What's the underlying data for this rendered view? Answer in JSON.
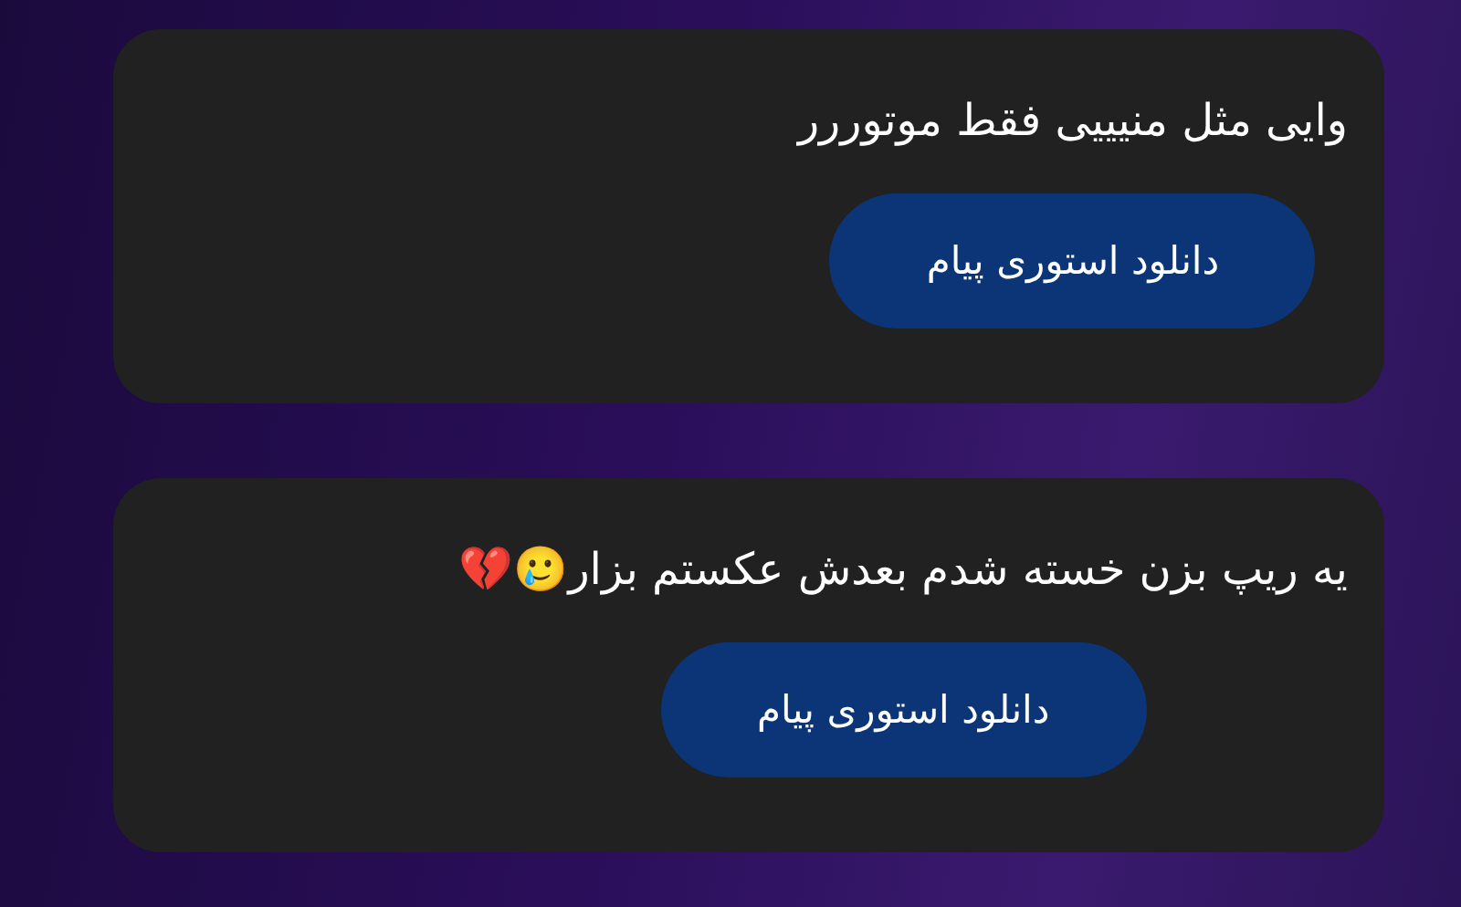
{
  "messages": [
    {
      "text": "وایی مثل منیییی فقط موتوررر",
      "button": "دانلود استوری پیام"
    },
    {
      "text": "یه ریپ بزن خسته شدم بعدش عکستم بزار🥲💔",
      "button": "دانلود استوری پیام"
    }
  ]
}
